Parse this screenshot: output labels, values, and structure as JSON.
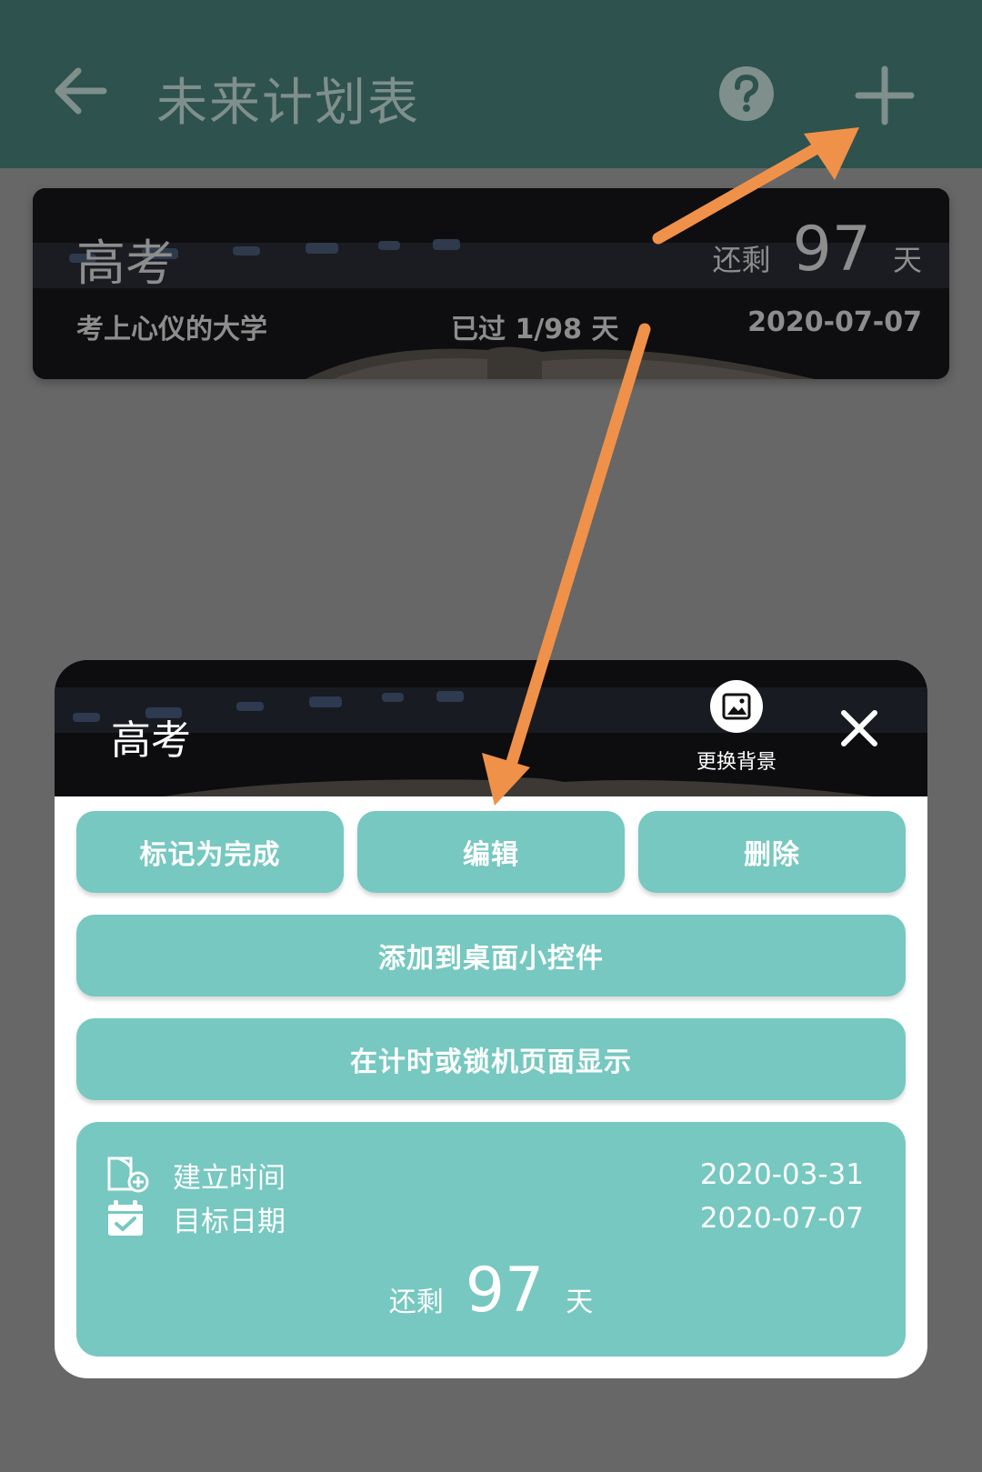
{
  "appbar": {
    "title": "未来计划表",
    "back_icon": "arrow-left-icon",
    "help_icon": "help-circle-icon",
    "add_icon": "plus-icon"
  },
  "plan_card": {
    "name": "高考",
    "remain_label": "还剩",
    "remain_days": "97",
    "remain_unit": "天",
    "subtitle": "考上心仪的大学",
    "passed": "已过 1/98 天",
    "target_date": "2020-07-07"
  },
  "dialog": {
    "title": "高考",
    "change_bg_label": "更换背景",
    "change_bg_icon": "image-icon",
    "close_icon": "close-icon",
    "buttons": {
      "mark_done": "标记为完成",
      "edit": "编辑",
      "delete": "删除",
      "add_widget": "添加到桌面小控件",
      "show_lock": "在计时或锁机页面显示"
    },
    "info": {
      "created_label": "建立时间",
      "created_value": "2020-03-31",
      "target_label": "目标日期",
      "target_value": "2020-07-07",
      "remain_label": "还剩",
      "remain_days": "97",
      "remain_unit": "天"
    }
  },
  "colors": {
    "accent": "#76c8c0",
    "appbar": "#2e524e",
    "annotation_arrow": "#f0914a"
  }
}
